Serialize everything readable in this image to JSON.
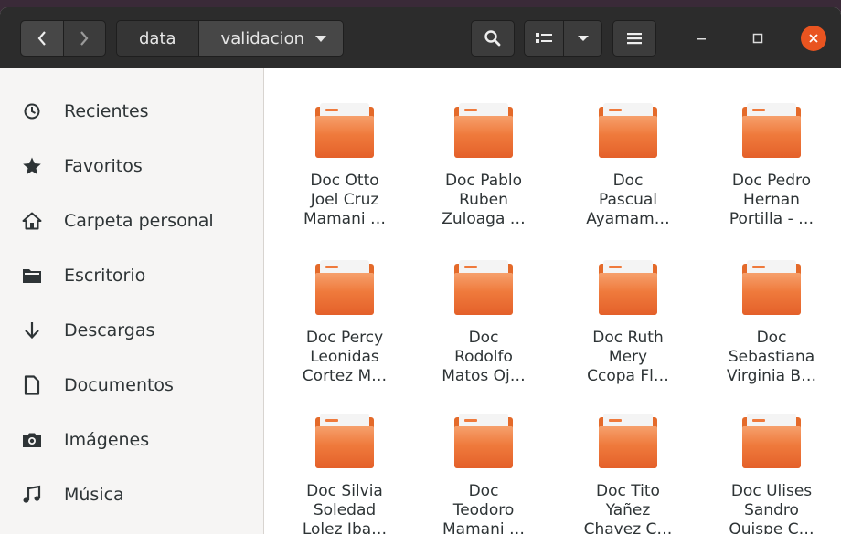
{
  "header": {
    "back_symbol": "‹",
    "forward_symbol": "›",
    "breadcrumbs": [
      "data",
      "validacion"
    ]
  },
  "sidebar": {
    "items": [
      {
        "label": "Recientes",
        "icon": "clock-icon"
      },
      {
        "label": "Favoritos",
        "icon": "star-icon"
      },
      {
        "label": "Carpeta personal",
        "icon": "home-icon"
      },
      {
        "label": "Escritorio",
        "icon": "desktop-folder-icon"
      },
      {
        "label": "Descargas",
        "icon": "download-icon"
      },
      {
        "label": "Documentos",
        "icon": "document-icon"
      },
      {
        "label": "Imágenes",
        "icon": "camera-icon"
      },
      {
        "label": "Música",
        "icon": "music-icon"
      }
    ]
  },
  "files": [
    {
      "lines": [
        "Doc Otto",
        "Joel Cruz",
        "Mamani …"
      ]
    },
    {
      "lines": [
        "Doc Pablo",
        "Ruben",
        "Zuloaga …"
      ]
    },
    {
      "lines": [
        "Doc",
        "Pascual",
        "Ayamam…"
      ]
    },
    {
      "lines": [
        "Doc Pedro",
        "Hernan",
        "Portilla - …"
      ]
    },
    {
      "lines": [
        "Doc Percy",
        "Leonidas",
        "Cortez M…"
      ]
    },
    {
      "lines": [
        "Doc",
        "Rodolfo",
        "Matos Oj…"
      ]
    },
    {
      "lines": [
        "Doc Ruth",
        "Mery",
        "Ccopa Fl…"
      ]
    },
    {
      "lines": [
        "Doc",
        "Sebastiana",
        "Virginia B…"
      ]
    },
    {
      "lines": [
        "Doc Silvia",
        "Soledad",
        "Lolez Iba…"
      ]
    },
    {
      "lines": [
        "Doc",
        "Teodoro",
        "Mamani …"
      ]
    },
    {
      "lines": [
        "Doc Tito",
        "Yañez",
        "Chavez C…"
      ]
    },
    {
      "lines": [
        "Doc Ulises",
        "Sandro",
        "Quispe C…"
      ]
    }
  ],
  "colors": {
    "folder": "#ef7a3c",
    "close_button": "#e95420",
    "header": "#2c2c2c"
  }
}
